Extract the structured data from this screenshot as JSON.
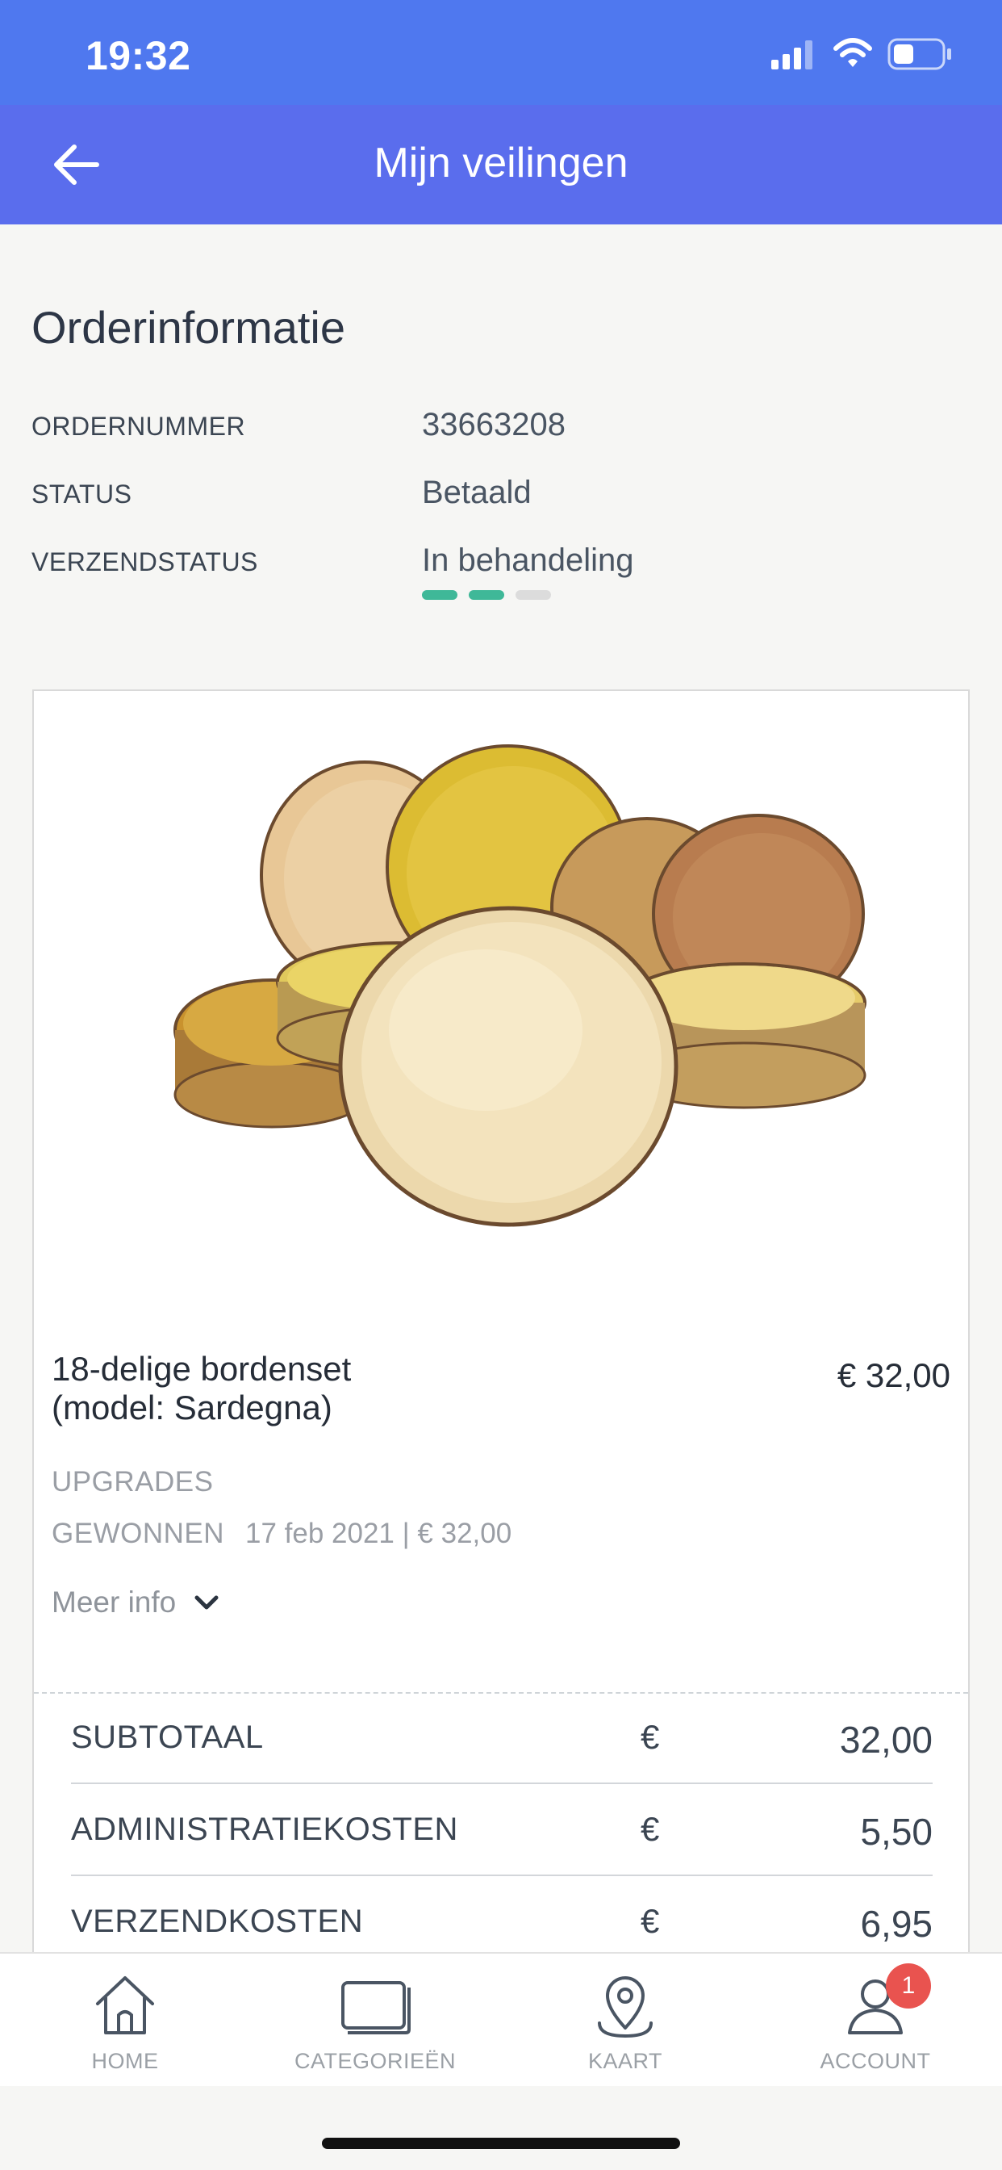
{
  "status_bar": {
    "time": "19:32",
    "icons": [
      "cellular-signal-icon",
      "wifi-icon",
      "battery-icon"
    ]
  },
  "header": {
    "title": "Mijn veilingen",
    "back_icon": "arrow-left-icon"
  },
  "order_info": {
    "title": "Orderinformatie",
    "rows": [
      {
        "label": "ORDERNUMMER",
        "value": "33663208"
      },
      {
        "label": "STATUS",
        "value": "Betaald"
      },
      {
        "label": "VERZENDSTATUS",
        "value": "In behandeling"
      }
    ],
    "shipping_progress": {
      "completed_steps": 2,
      "total_steps": 3
    }
  },
  "product": {
    "title_line1": "18-delige bordenset",
    "title_line2": "(model: Sardegna)",
    "price": "€ 32,00",
    "upgrades_label": "UPGRADES",
    "won_label": "GEWONNEN",
    "won_details": "17 feb 2021 | € 32,00",
    "more_info": "Meer info",
    "more_info_icon": "chevron-down-icon"
  },
  "costs": [
    {
      "label": "SUBTOTAAL",
      "currency": "€",
      "amount": "32,00"
    },
    {
      "label": "ADMINISTRATIEKOSTEN",
      "currency": "€",
      "amount": "5,50"
    },
    {
      "label": "VERZENDKOSTEN",
      "currency": "€",
      "amount": "6,95"
    }
  ],
  "tabs": [
    {
      "label": "HOME",
      "icon": "home-icon"
    },
    {
      "label": "CATEGORIEËN",
      "icon": "categories-icon"
    },
    {
      "label": "KAART",
      "icon": "map-pin-icon"
    },
    {
      "label": "ACCOUNT",
      "icon": "user-icon",
      "badge": "1"
    }
  ],
  "colors": {
    "status_bar": "#4f78ef",
    "nav_bar": "#5a6ded",
    "progress_done": "#3fb898",
    "progress_todo": "#dcdcdc",
    "badge": "#e9534f"
  }
}
